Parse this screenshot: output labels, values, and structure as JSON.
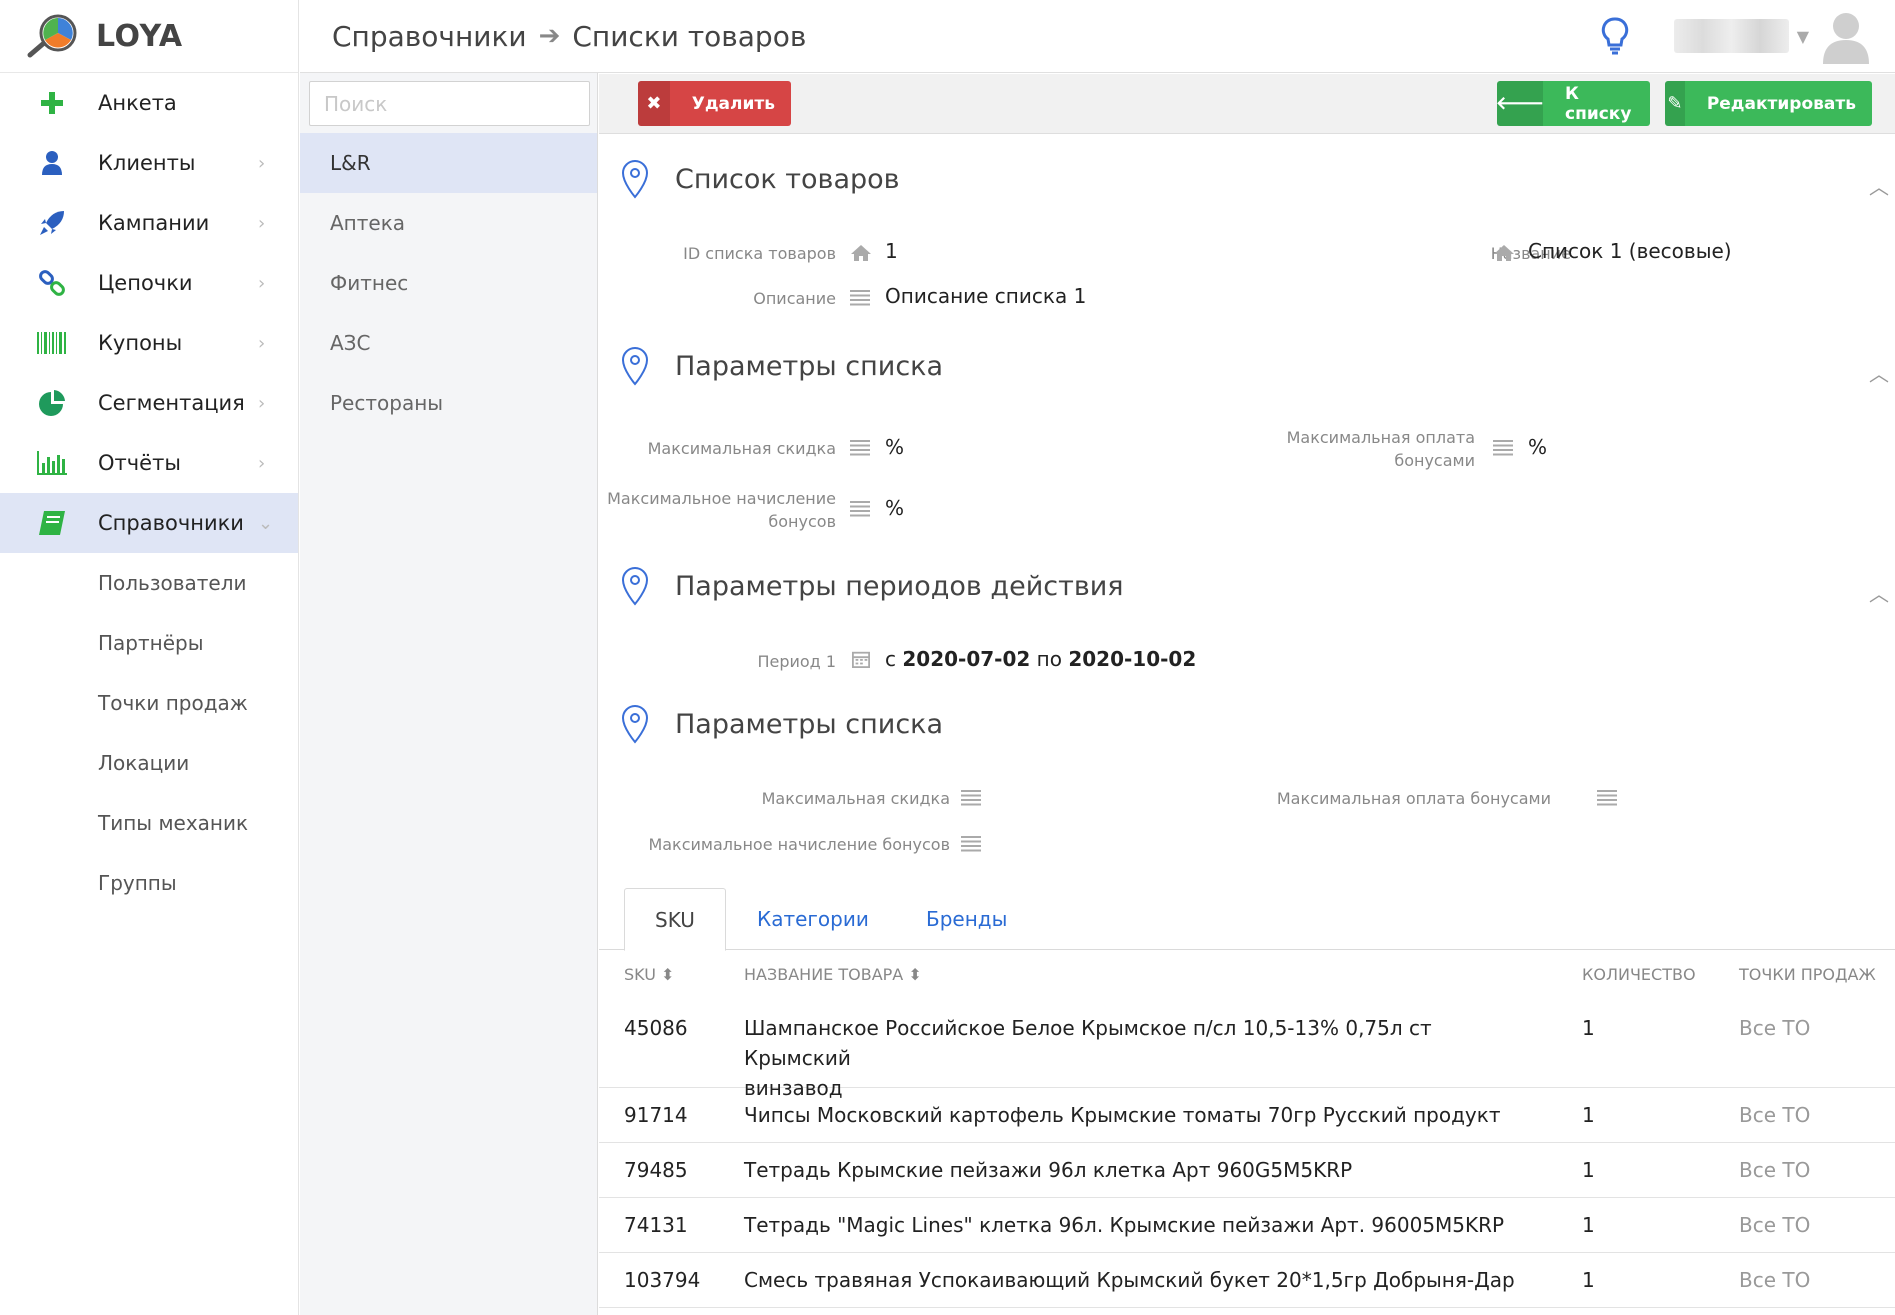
{
  "app": {
    "name": "LOYA"
  },
  "sidebar": {
    "items": [
      {
        "label": "Анкета",
        "icon": "plus-icon"
      },
      {
        "label": "Клиенты",
        "icon": "user-icon"
      },
      {
        "label": "Кампании",
        "icon": "rocket-icon"
      },
      {
        "label": "Цепочки",
        "icon": "link-icon"
      },
      {
        "label": "Купоны",
        "icon": "barcode-icon"
      },
      {
        "label": "Сегментация",
        "icon": "pie-chart-icon"
      },
      {
        "label": "Отчёты",
        "icon": "bar-chart-icon"
      },
      {
        "label": "Справочники",
        "icon": "book-icon"
      }
    ],
    "subitems": [
      "Пользователи",
      "Партнёры",
      "Точки продаж",
      "Локации",
      "Типы механик",
      "Группы"
    ]
  },
  "breadcrumb": {
    "parent": "Справочники",
    "current": "Списки товаров"
  },
  "listpanel": {
    "search_placeholder": "Поиск",
    "items": [
      "L&R",
      "Аптека",
      "Фитнес",
      "АЗС",
      "Рестораны"
    ]
  },
  "toolbar": {
    "delete": "Удалить",
    "back": "К списку",
    "edit": "Редактировать"
  },
  "sections": {
    "list": {
      "title": "Список товаров",
      "id_label": "ID списка товаров",
      "id_value": "1",
      "name_label": "Название",
      "name_value": "Список 1 (весовые)",
      "desc_label": "Описание",
      "desc_value": "Описание списка 1"
    },
    "params": {
      "title": "Параметры списка",
      "max_discount_label": "Максимальная скидка",
      "max_discount_value": "%",
      "max_bonus_pay_label_1": "Максимальная оплата",
      "max_bonus_pay_label_2": "бонусами",
      "max_bonus_pay_value": "%",
      "max_bonus_accrual_label_1": "Максимальное начисление",
      "max_bonus_accrual_label_2": "бонусов",
      "max_bonus_accrual_value": "%"
    },
    "periods": {
      "title": "Параметры периодов действия",
      "period_label": "Период 1",
      "from_word": "с",
      "from_date": "2020-07-02",
      "to_word": "по",
      "to_date": "2020-10-02"
    },
    "params2": {
      "title": "Параметры списка",
      "max_discount_label": "Максимальная скидка",
      "max_bonus_pay_label": "Максимальная оплата бонусами",
      "max_bonus_accrual_label": "Максимальное начисление бонусов"
    }
  },
  "tabs": [
    "SKU",
    "Категории",
    "Бренды"
  ],
  "table": {
    "headers": {
      "sku": "SKU",
      "name": "НАЗВАНИЕ ТОВАРА",
      "qty": "КОЛИЧЕСТВО",
      "points": "ТОЧКИ ПРОДАЖ"
    },
    "rows": [
      {
        "sku": "45086",
        "name_1": "Шампанское Российское Белое Крымское п/сл 10,5-13% 0,75л ст Крымский",
        "name_2": "винзавод",
        "qty": "1",
        "points": "Все ТО"
      },
      {
        "sku": "91714",
        "name_1": "Чипсы Московский картофель Крымские томаты 70гр Русский продукт",
        "qty": "1",
        "points": "Все ТО"
      },
      {
        "sku": "79485",
        "name_1": "Тетрадь Крымские пейзажи 96л клетка Арт 960G5M5KRP",
        "qty": "1",
        "points": "Все ТО"
      },
      {
        "sku": "74131",
        "name_1": "Тетрадь \"Magic Lines\" клетка 96л. Крымские пейзажи Арт. 96005M5KRP",
        "qty": "1",
        "points": "Все ТО"
      },
      {
        "sku": "103794",
        "name_1": "Смесь травяная Успокаивающий Крымский букет 20*1,5гр Добрыня-Дар",
        "qty": "1",
        "points": "Все ТО"
      }
    ]
  },
  "colors": {
    "accent": "#2a6bd4",
    "danger": "#d64545",
    "success": "#3cb95a",
    "active_bg": "#dfe5f5"
  }
}
